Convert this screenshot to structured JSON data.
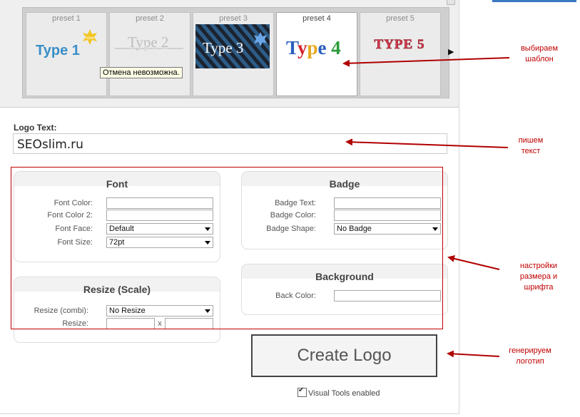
{
  "presets": [
    {
      "label": "preset 1",
      "sample": "Type 1",
      "badge": "New",
      "active": false
    },
    {
      "label": "preset 2",
      "sample": "Type 2",
      "active": false
    },
    {
      "label": "preset 3",
      "sample": "Type 3",
      "active": false
    },
    {
      "label": "preset 4",
      "sample": "Type 4",
      "active": true
    },
    {
      "label": "preset 5",
      "sample": "TYPE 5",
      "active": false
    }
  ],
  "tooltip": "Отмена невозможна.",
  "logo_text": {
    "label": "Logo Text:",
    "value": "SEOslim.ru"
  },
  "font": {
    "title": "Font",
    "color_label": "Font Color:",
    "color2_label": "Font Color 2:",
    "face_label": "Font Face:",
    "face_value": "Default",
    "size_label": "Font Size:",
    "size_value": "72pt"
  },
  "badge": {
    "title": "Badge",
    "text_label": "Badge Text:",
    "color_label": "Badge Color:",
    "shape_label": "Badge Shape:",
    "shape_value": "No Badge"
  },
  "resize": {
    "title": "Resize (Scale)",
    "combi_label": "Resize (combi):",
    "combi_value": "No Resize",
    "resize_label": "Resize:",
    "separator": "x"
  },
  "background": {
    "title": "Background",
    "color_label": "Back Color:"
  },
  "create_button": "Create Logo",
  "visual_tools": "Visual Tools enabled",
  "annotations": {
    "template": "выбираем\nшаблон",
    "text": "пишем\nтекст",
    "settings": "настройки\nразмера и\nшрифта",
    "generate": "генерируем\nлоготип"
  },
  "colors": {
    "annotation": "#c00000",
    "link_bar": "#3a78c0"
  }
}
